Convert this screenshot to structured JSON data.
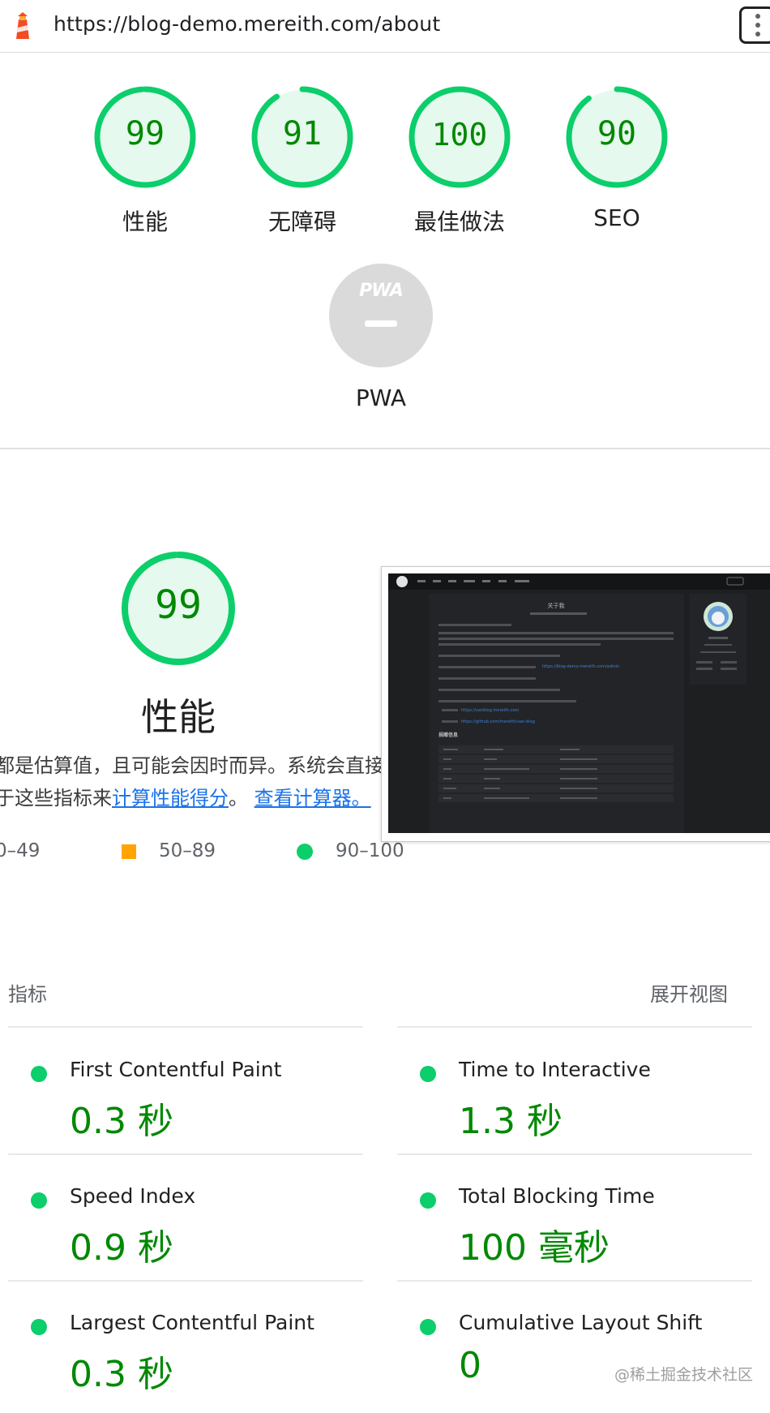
{
  "browser": {
    "url": "https://blog-demo.mereith.com/about"
  },
  "categories": [
    {
      "score": "99",
      "label": "性能",
      "value": 99
    },
    {
      "score": "91",
      "label": "无障碍",
      "value": 91
    },
    {
      "score": "100",
      "label": "最佳做法",
      "value": 100
    },
    {
      "score": "90",
      "label": "SEO",
      "value": 90
    }
  ],
  "pwa": {
    "badge": "PWA",
    "label": "PWA"
  },
  "performance": {
    "score": "99",
    "value": 99,
    "title": "性能",
    "desc_line1": "都是估算值，且可能会因时而异。系统会直接基",
    "desc_line2_prefix": "于这些指标来",
    "link_calc": "计算性能得分",
    "sep": "。",
    "link_calculator": "查看计算器。",
    "legend": {
      "range1": "0–49",
      "range2": "50–89",
      "range3": "90–100"
    }
  },
  "thumbnail": {
    "page_title": "关于我",
    "section_heading": "捐赠信息",
    "link1": "https://blog-demo.mereith.com/admin",
    "link2": "https://vanblog.mereith.com",
    "link3": "https://github.com/mereith/van-blog"
  },
  "metrics": {
    "header_left": "指标",
    "header_right": "展开视图",
    "items": [
      {
        "name": "First Contentful Paint",
        "value": "0.3 秒"
      },
      {
        "name": "Time to Interactive",
        "value": "1.3 秒"
      },
      {
        "name": "Speed Index",
        "value": "0.9 秒"
      },
      {
        "name": "Total Blocking Time",
        "value": "100 毫秒"
      },
      {
        "name": "Largest Contentful Paint",
        "value": "0.3 秒"
      },
      {
        "name": "Cumulative Layout Shift",
        "value": "0"
      }
    ]
  },
  "watermark": "@稀土掘金技术社区",
  "colors": {
    "pass": "#0cce6b",
    "pass_text": "#008800",
    "pass_bg": "#e6f9ee",
    "average": "#ffa400",
    "link": "#1a73e8",
    "pwa_gray": "#dadada"
  }
}
